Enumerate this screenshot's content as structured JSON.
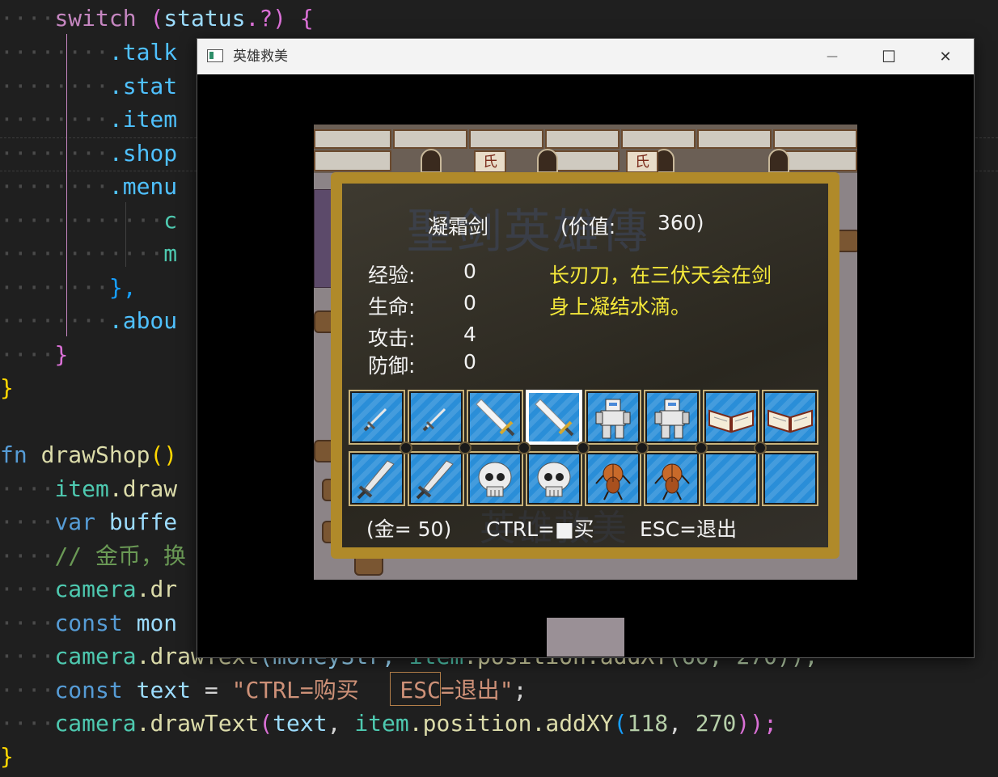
{
  "editor": {
    "lines": [
      {
        "t1": "switch",
        "t2": " (",
        "t3": "status",
        "t4": ".?) {"
      },
      {
        "t1": ".talk"
      },
      {
        "t1": ".stat"
      },
      {
        "t1": ".item"
      },
      {
        "t1": ".shop"
      },
      {
        "t1": ".menu"
      },
      {
        "t1": "c"
      },
      {
        "t1": "m"
      },
      {
        "t1": "},"
      },
      {
        "t1": ".abou"
      },
      {
        "t1": "}"
      },
      {
        "t1": "}"
      },
      {
        "t1": "fn",
        "t2": " drawShop",
        "t3": "()"
      },
      {
        "t1": "item",
        "t2": ".draw"
      },
      {
        "t1": "var",
        "t2": " buffe"
      },
      {
        "t1": "// 金币，换"
      },
      {
        "t1": "camera",
        "t2": ".dr"
      },
      {
        "t1": "const",
        "t2": " mon"
      },
      {
        "t1": "camera",
        "t2": ".drawText",
        "t3": "(moneyStr, ",
        "t4": "item",
        "t5": ".position.addXY",
        "t6": "(60, 270));"
      },
      {
        "t1": "const",
        "t2": " text",
        "t3": " = ",
        "t4": "\"CTRL=购买",
        "t5": "ESC=退出\"",
        "t6": ";"
      },
      {
        "t1": "camera",
        "t2": ".drawText",
        "t3": "(",
        "t4": "text",
        "t5": ", ",
        "t6": "item",
        "t7": ".position.addXY",
        "t8": "(",
        "t9": "118",
        "t10": ", ",
        "t11": "270",
        "t12": "));"
      },
      {
        "t1": "}"
      }
    ]
  },
  "window": {
    "title": "英雄救美",
    "minimize": "—",
    "maximize": "☐",
    "close": "✕"
  },
  "scene": {
    "signs": [
      "氏",
      "氏"
    ]
  },
  "shop": {
    "watermark_top": "聖剑英雄傳",
    "watermark_bottom": "英雄救美",
    "item_name": "凝霜剑",
    "price_label": "(价值:",
    "price_value": "360)",
    "stats": [
      {
        "label": "经验:",
        "value": "0"
      },
      {
        "label": "生命:",
        "value": "0"
      },
      {
        "label": "攻击:",
        "value": "4"
      },
      {
        "label": "防御:",
        "value": "0"
      }
    ],
    "description_line1": "长刃刀，在三伏天会在剑",
    "description_line2": "身上凝结水滴。",
    "gold": "(金= 50)",
    "ctrl_hint": "CTRL=■买",
    "esc_hint": "ESC=退出",
    "items_row1": [
      "short-sword-icon",
      "short-sword-icon",
      "broad-sword-icon",
      "broad-sword-icon",
      "mech-armor-icon",
      "mech-armor-icon",
      "open-book-icon",
      "open-book-icon"
    ],
    "items_row2": [
      "long-sword-icon",
      "long-sword-icon",
      "skull-icon",
      "skull-icon",
      "bug-icon",
      "bug-icon",
      "empty-slot",
      "empty-slot"
    ],
    "selected_index": 3
  }
}
